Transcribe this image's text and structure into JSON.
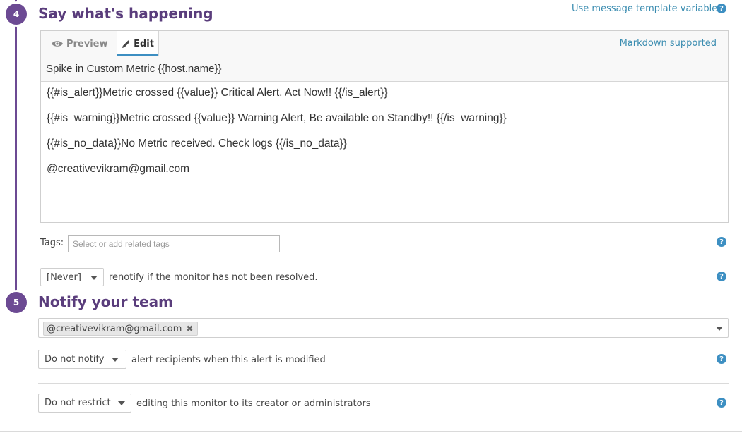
{
  "step4": {
    "number": "4",
    "title": "Say what's happening",
    "template_link": "Use message template variables",
    "help": "?",
    "tabs": [
      {
        "label": "Preview",
        "icon": "eye-icon"
      },
      {
        "label": "Edit",
        "icon": "pencil-icon"
      }
    ],
    "active_tab": "Edit",
    "markdown_note": "Markdown supported",
    "message_title": "Spike in Custom Metric {{host.name}}",
    "message_lines": [
      "{{#is_alert}}Metric crossed {{value}} Critical Alert, Act Now!! {{/is_alert}}",
      "{{#is_warning}}Metric crossed {{value}} Warning Alert, Be available on Standby!! {{/is_warning}}",
      "{{#is_no_data}}No Metric received. Check logs {{/is_no_data}}",
      "@creativevikram@gmail.com"
    ],
    "tags_label": "Tags:",
    "tags_placeholder": "Select or add related tags",
    "renotify_value": "[Never]",
    "renotify_text": "renotify if the monitor has not been resolved."
  },
  "step5": {
    "number": "5",
    "title": "Notify your team",
    "recipients": [
      "@creativevikram@gmail.com"
    ],
    "notify_value": "Do not notify",
    "notify_text": "alert recipients when this alert is modified",
    "restrict_value": "Do not restrict",
    "restrict_text": "editing this monitor to its creator or administrators"
  },
  "colors": {
    "accent_purple": "#6c4a93",
    "link_blue": "#3a8cb0",
    "help_blue": "#3d8fc2"
  }
}
